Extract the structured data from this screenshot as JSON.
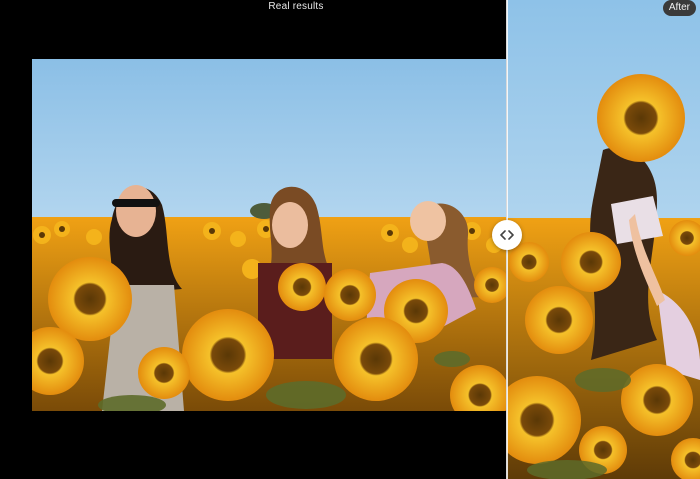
{
  "caption": "Real results",
  "after_label": "After",
  "icons": {
    "compare_handle": "chevrons-left-right-icon"
  },
  "colors": {
    "background": "#000000",
    "sky": "#9ecbea",
    "sunflower": "#f2b21a"
  }
}
